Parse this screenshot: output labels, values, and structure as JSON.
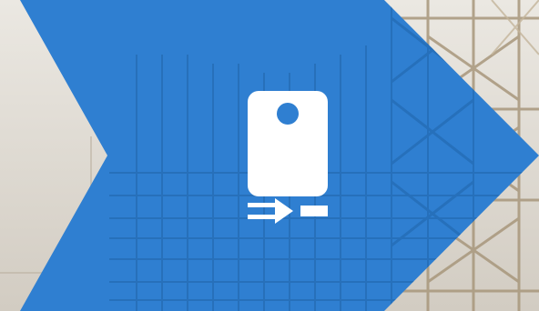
{
  "colors": {
    "chevron": "#2f7fd1",
    "icon": "#ffffff",
    "icon_dot": "#2f7fd1",
    "sky": "#e3dfd8",
    "scaffold": "#9c8f7a"
  },
  "icons": {
    "main": "device-with-arrow-icon"
  }
}
